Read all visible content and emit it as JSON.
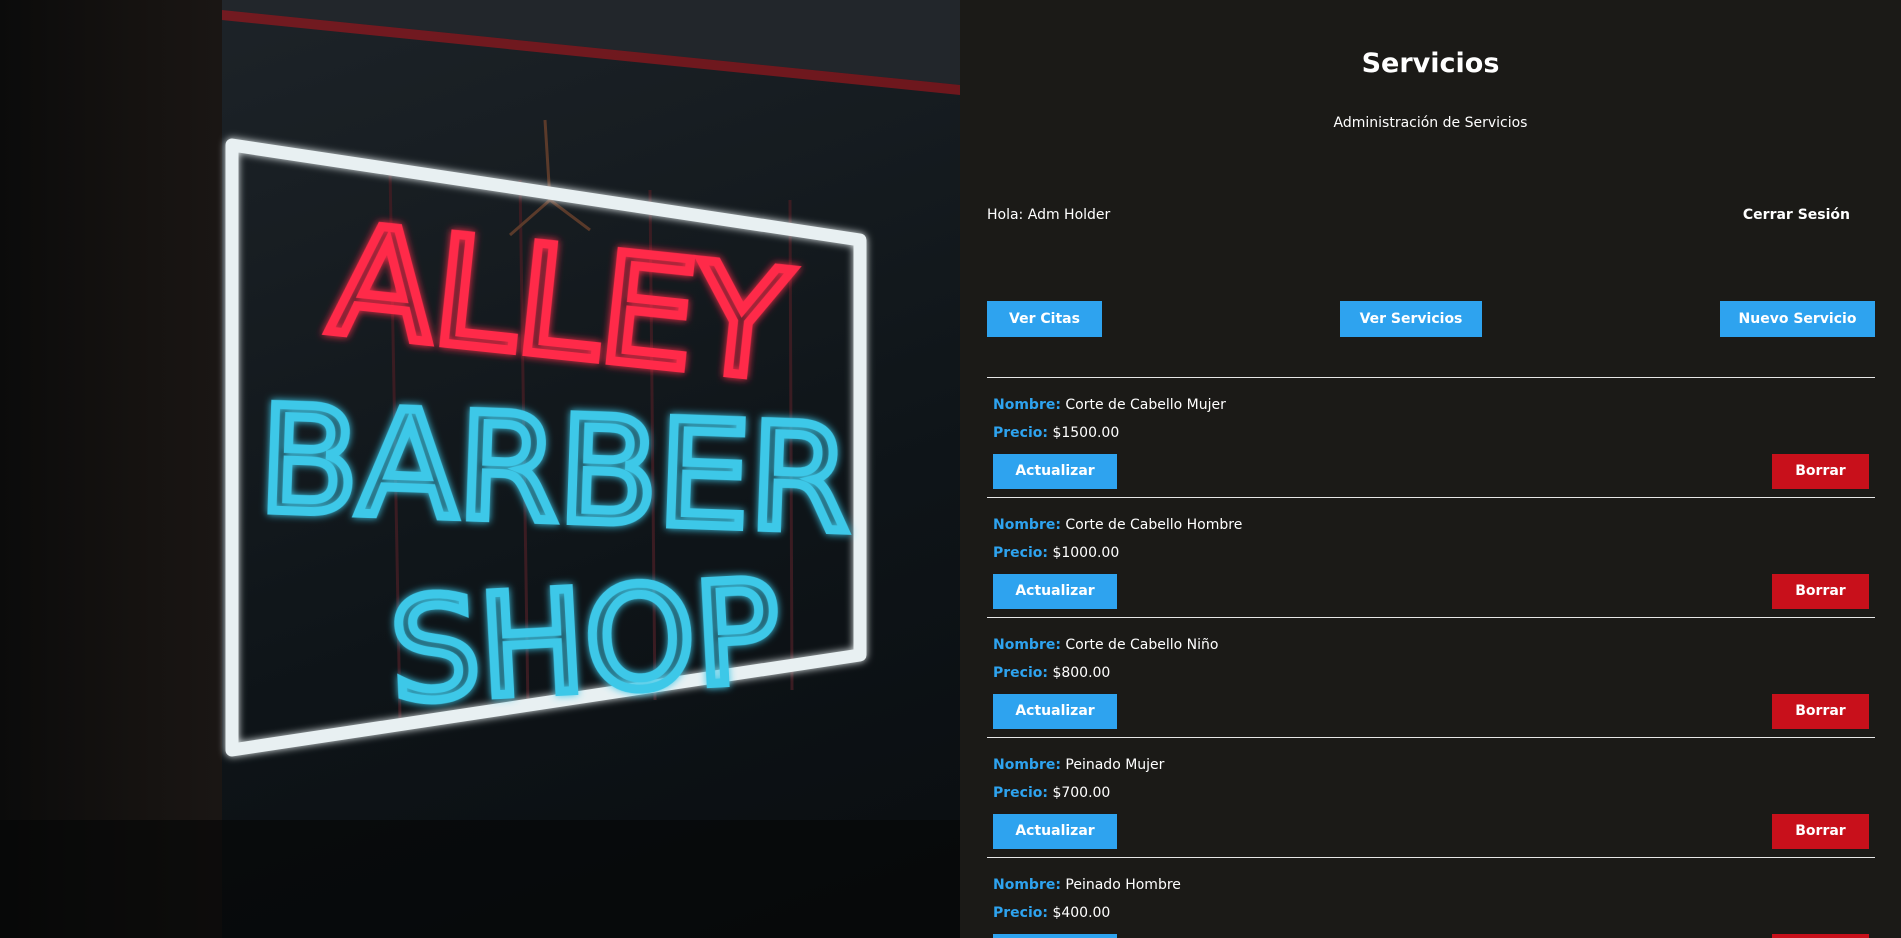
{
  "page": {
    "title": "Servicios",
    "subtitle": "Administración de Servicios"
  },
  "hero": {
    "sign_line1": "ALLEY",
    "sign_line2": "BARBER",
    "sign_line3": "SHOP",
    "colors": {
      "neon_red": "#ff2b4a",
      "neon_blue": "#3ec8e8",
      "neon_white": "#e8f0f2"
    }
  },
  "session": {
    "greeting_prefix": "Hola:",
    "user_name": "Adm Holder",
    "logout_label": "Cerrar Sesión"
  },
  "actions": {
    "ver_citas": "Ver Citas",
    "ver_servicios": "Ver Servicios",
    "nuevo_servicio": "Nuevo Servicio"
  },
  "labels": {
    "nombre": "Nombre:",
    "precio": "Precio:",
    "actualizar": "Actualizar",
    "borrar": "Borrar"
  },
  "services": [
    {
      "name": "Corte de Cabello Mujer",
      "price": "$1500.00"
    },
    {
      "name": "Corte de Cabello Hombre",
      "price": "$1000.00"
    },
    {
      "name": "Corte de Cabello Niño",
      "price": "$800.00"
    },
    {
      "name": "Peinado Mujer",
      "price": "$700.00"
    },
    {
      "name": "Peinado Hombre",
      "price": "$400.00"
    }
  ],
  "colors": {
    "background": "#1b1a17",
    "accent_blue": "#2ea3ef",
    "danger_red": "#c8101b",
    "divider": "#e6e6e6"
  }
}
